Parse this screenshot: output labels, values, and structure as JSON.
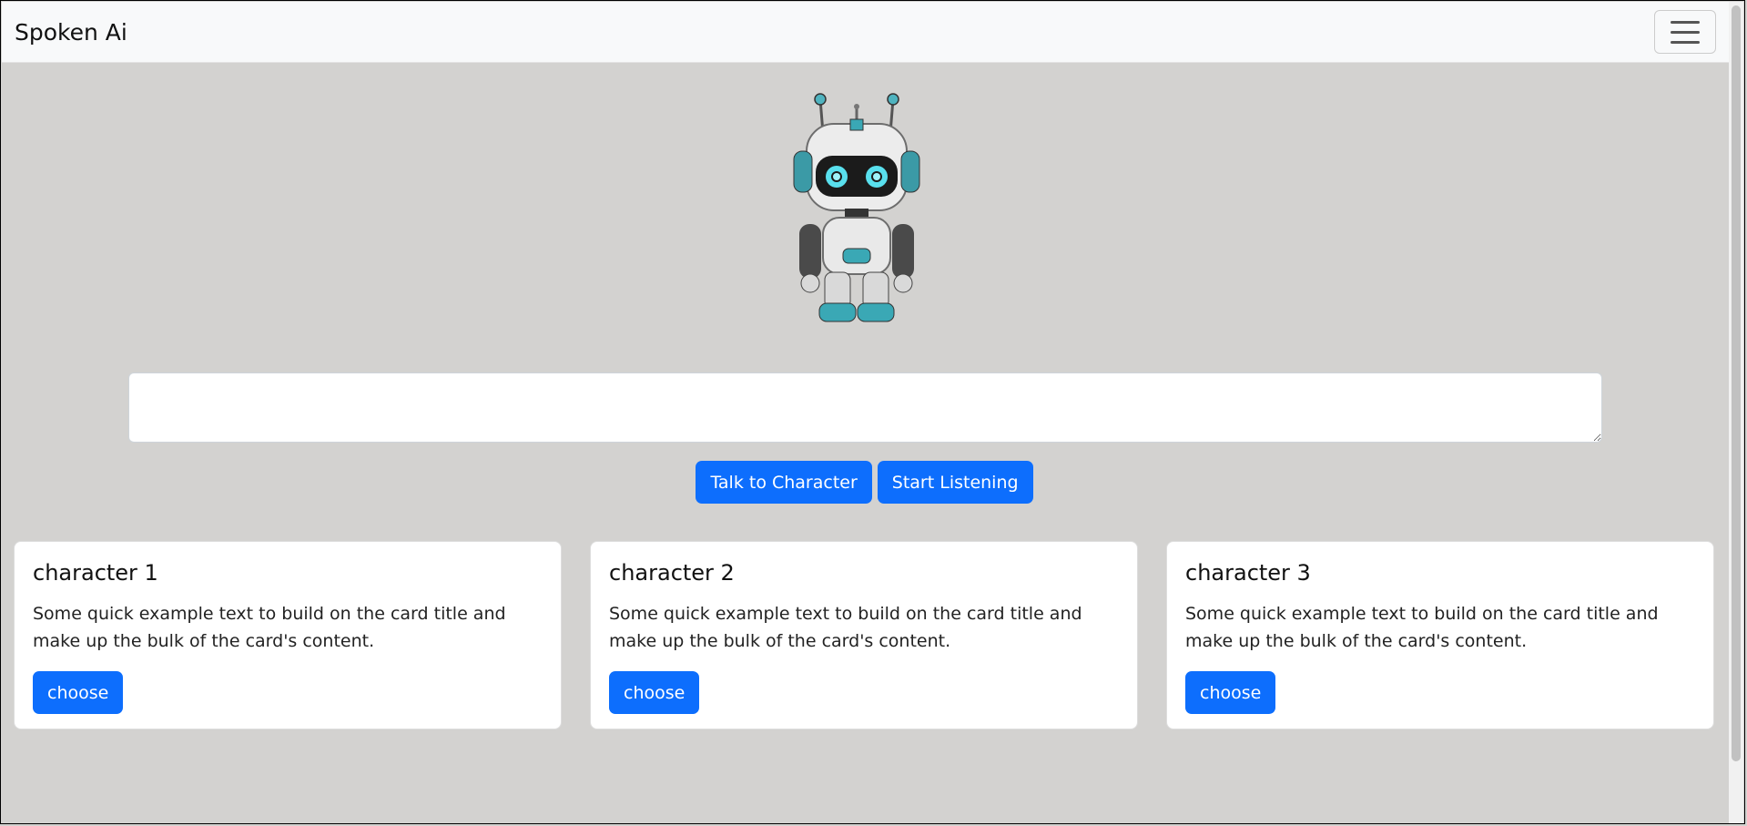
{
  "navbar": {
    "brand": "Spoken Ai",
    "menu_icon": "hamburger-icon"
  },
  "hero": {
    "image": "robot-character-image"
  },
  "input": {
    "value": "",
    "placeholder": ""
  },
  "actions": {
    "talk": "Talk to Character",
    "listen": "Start Listening"
  },
  "cards": [
    {
      "title": "character 1",
      "text": "Some quick example text to build on the card title and make up the bulk of the card's content.",
      "button": "choose"
    },
    {
      "title": "character 2",
      "text": "Some quick example text to build on the card title and make up the bulk of the card's content.",
      "button": "choose"
    },
    {
      "title": "character 3",
      "text": "Some quick example text to build on the card title and make up the bulk of the card's content.",
      "button": "choose"
    }
  ],
  "colors": {
    "primary": "#0d6efd",
    "background": "#d3d2d0",
    "navbar": "#f8f9fa"
  }
}
